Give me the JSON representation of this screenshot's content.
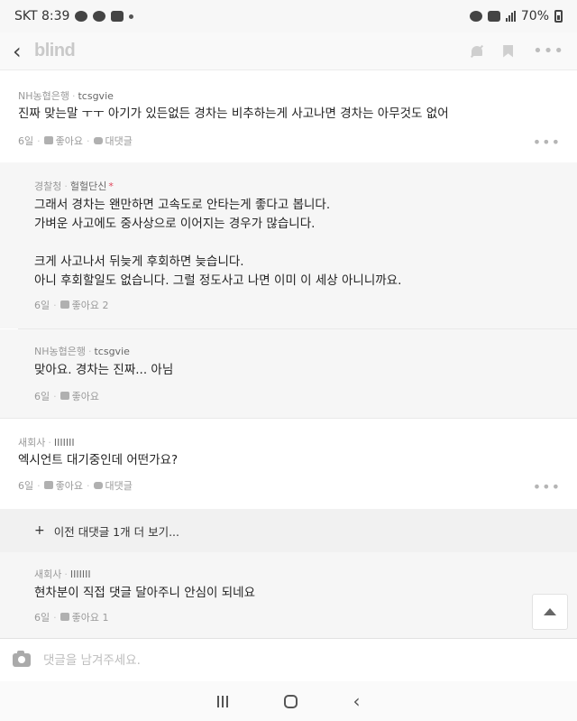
{
  "status_bar": {
    "carrier_time": "SKT 8:39",
    "dot": "•",
    "battery": "70%"
  },
  "app_bar": {
    "logo": "blind",
    "back_icon": "chevron-left"
  },
  "comments": [
    {
      "company": "NH농협은행",
      "user": "tcsgvie",
      "lines": [
        "진짜 맞는말 ㅜㅜ 아기가 있든없든 경차는 비추하는게 사고나면 경차는 아무것도 없어"
      ],
      "time": "6일",
      "like": "좋아요",
      "reply": "대댓글"
    },
    {
      "company": "경찰청",
      "user": "헐헐단신",
      "badge": "*",
      "lines": [
        "그래서 경차는 왠만하면 고속도로 안타는게 좋다고 봅니다.",
        "가벼운 사고에도 중사상으로 이어지는 경우가 많습니다.",
        "",
        "크게 사고나서 뒤늦게 후회하면 늦습니다.",
        "아니 후회할일도 없습니다. 그럴 정도사고 나면 이미 이 세상 아니니까요."
      ],
      "time": "6일",
      "like": "좋아요 2"
    },
    {
      "company": "NH농협은행",
      "user": "tcsgvie",
      "lines": [
        "맞아요. 경차는 진짜... 아님"
      ],
      "time": "6일",
      "like": "좋아요"
    },
    {
      "company": "새회사",
      "user": "IIIIIII",
      "lines": [
        "엑시언트 대기중인데 어떤가요?"
      ],
      "time": "6일",
      "like": "좋아요",
      "reply": "대댓글"
    },
    {
      "company": "새회사",
      "user": "IIIIIII",
      "lines": [
        "현차분이 직접 댓글 달아주니 안심이 되네요"
      ],
      "time": "6일",
      "like": "좋아요 1"
    }
  ],
  "more_replies": {
    "plus": "+",
    "label": "이전 대댓글 1개 더 보기..."
  },
  "input": {
    "placeholder": "댓글을 남겨주세요."
  },
  "icons": [
    "back-icon",
    "bell-off-icon",
    "bookmark-icon",
    "more-icon",
    "thumb-up-icon",
    "comment-icon",
    "camera-icon",
    "scroll-top-icon",
    "nav-recent-icon",
    "nav-home-icon",
    "nav-back-icon"
  ],
  "colors": {
    "badge": "#e0465b",
    "logo": "#c9c9c9",
    "reply_bg": "#f6f6f6"
  }
}
